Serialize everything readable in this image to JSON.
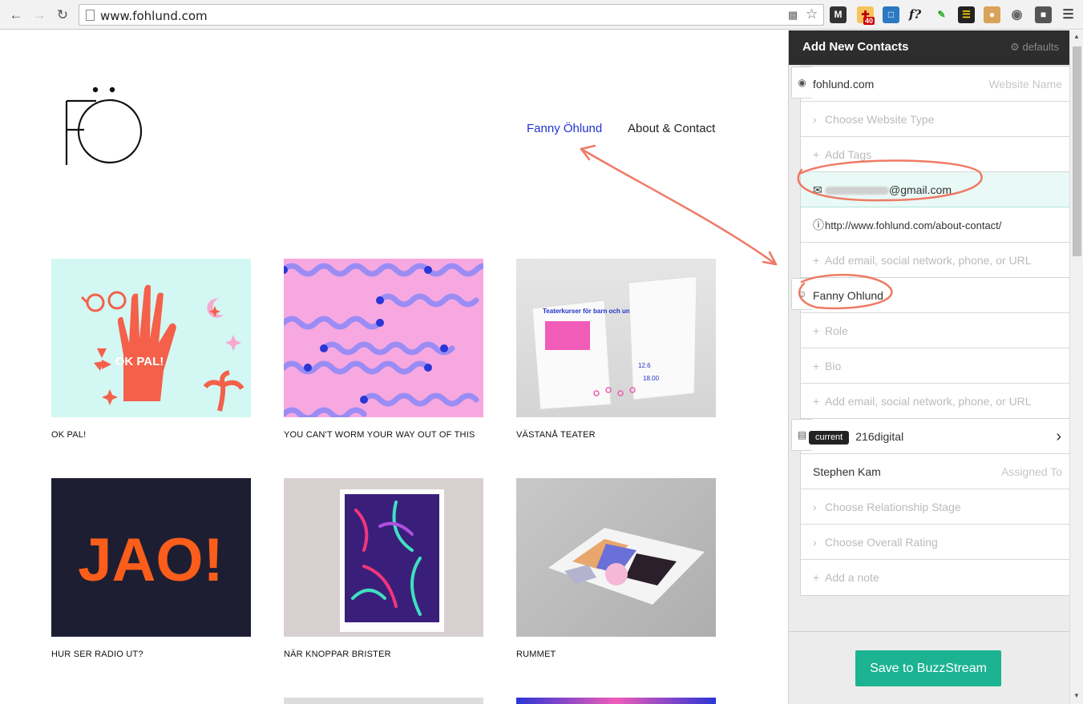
{
  "browser": {
    "url": "www.fohlund.com",
    "ext_badge": "40"
  },
  "site": {
    "nav": {
      "active": "Fanny Öhlund",
      "contact": "About & Contact"
    },
    "projects": [
      {
        "caption": "OK PAL!"
      },
      {
        "caption": "YOU CAN'T WORM YOUR WAY OUT OF THIS"
      },
      {
        "caption": "VÄSTANÅ TEATER"
      },
      {
        "caption": "HUR SER RADIO UT?"
      },
      {
        "caption": "NÄR KNOPPAR BRISTER"
      },
      {
        "caption": "RUMMET"
      }
    ],
    "art": {
      "okpal": "OK PAL!",
      "jao": "JAO!",
      "poster_title": "Teaterkurser för barn och unga",
      "poster_a": "12.6",
      "poster_b": "18.00"
    }
  },
  "panel": {
    "title": "Add New Contacts",
    "defaults": "defaults",
    "website": {
      "name": "fohlund.com",
      "name_hint": "Website Name",
      "type": "Choose Website Type",
      "tags": "Add Tags",
      "email": "@gmail.com",
      "url": "http://www.fohlund.com/about-contact/",
      "add": "Add email, social network, phone, or URL"
    },
    "person": {
      "name": "Fanny Ohlund",
      "role": "Role",
      "bio": "Bio",
      "add": "Add email, social network, phone, or URL"
    },
    "org": {
      "badge": "current",
      "name": "216digital",
      "assigned": "Stephen Kam",
      "assigned_hint": "Assigned To",
      "stage": "Choose Relationship Stage",
      "rating": "Choose Overall Rating",
      "note": "Add a note"
    },
    "save": "Save to BuzzStream"
  },
  "colors": {
    "accent": "#1bb391",
    "link": "#2233cc",
    "annotation": "#ee6b55"
  }
}
